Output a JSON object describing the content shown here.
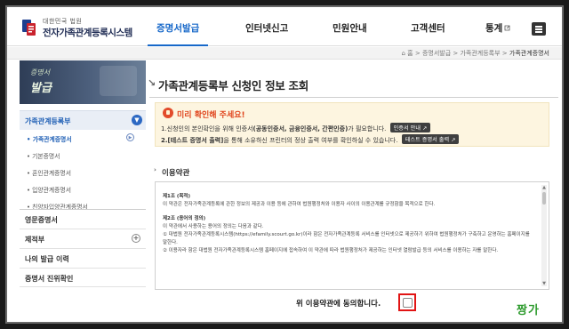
{
  "header": {
    "logo_sub": "대한민국 법원",
    "logo_title": "전자가족관계등록시스템",
    "nav": [
      "증명서발급",
      "인터넷신고",
      "민원안내",
      "고객센터",
      "통계"
    ],
    "menu_icon": "hamburger-icon"
  },
  "breadcrumb": [
    "홈",
    "증명서발급",
    "가족관계등록부",
    "가족관계증명서"
  ],
  "sidebar": {
    "banner_line1": "증명서",
    "banner_line2": "발급",
    "open_category": "가족관계등록부",
    "sub_items": [
      "가족관계증명서",
      "기본증명서",
      "혼인관계증명서",
      "입양관계증명서",
      "친양자입양관계증명서"
    ],
    "items": [
      "영문증명서",
      "제적부",
      "나의 발급 이력",
      "증명서 진위확인"
    ]
  },
  "main": {
    "title": "가족관계등록부 신청인 정보 조회",
    "notice": {
      "heading": "미리 확인해 주세요!",
      "line1_prefix": "1.신청인의 본인확인을 위해 인증서",
      "line1_bold": "(공동인증서, 금융인증서, 간편인증)",
      "line1_suffix": "가 필요합니다.",
      "line1_button": "인증서 안내",
      "line2_bold": "2.[테스트 증명서 출력]",
      "line2_suffix": "을 통해 소유하신 프린터의 정상 출력 여부를 확인하실 수 있습니다.",
      "line2_button": "테스트 증명서 출력"
    },
    "terms_label": "이용약관",
    "terms": [
      {
        "type": "h",
        "text": "제1조 (목적)"
      },
      {
        "type": "p",
        "text": "이 약관은 전자가족관계등록에 관한 정보의 제공과 이용 등에 관하여 법원행정처와 이용자 사이의 이용관계를 규정함을 목적으로 한다."
      },
      {
        "type": "h",
        "text": "제2조 (용어의 정의)"
      },
      {
        "type": "p",
        "text": "이 약관에서 사용하는 용어의 정의는 다음과 같다."
      },
      {
        "type": "p",
        "text": "① 대법원 전자가족관계등록시스템(https://efamily.scourt.go.kr)이라 함은 전자가족관계등록 서비스를 인터넷으로 제공하기 위하여 법원행정처가 구축하고 운영하는 홈페이지를 말한다."
      },
      {
        "type": "p",
        "text": "② 이용자라 함은 대법원 전자가족관계등록시스템 홈페이지에 접속하여 이 약관에 따라 법원행정처가 제공하는 인터넷 열람발급 등의 서비스를 이용하는 자를 말한다."
      }
    ],
    "agree_label": "위 이용약관에 동의합니다."
  },
  "watermark": "짱가"
}
